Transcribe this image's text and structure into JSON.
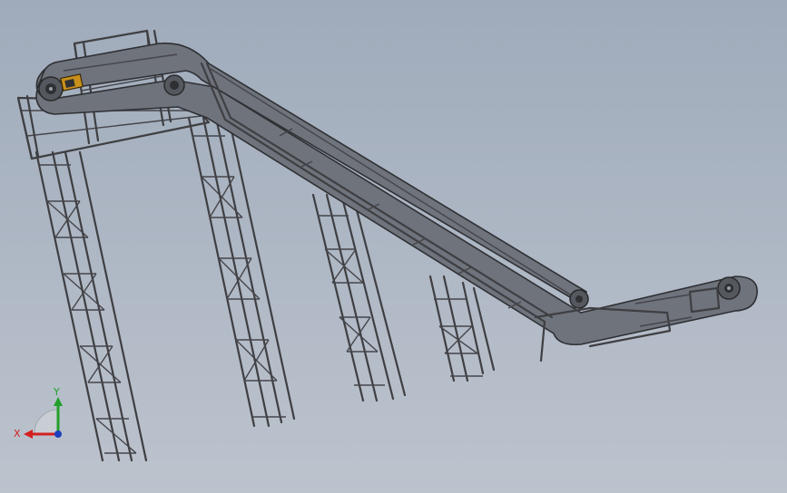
{
  "triad": {
    "x_label": "X",
    "y_label": "Y",
    "x_color": "#d42020",
    "y_color": "#22a02a",
    "z_color": "#1e3fbf"
  },
  "colors": {
    "background_top": "#9fabbb",
    "background_bottom": "#bcc3cd",
    "steel": "#3f3f42",
    "belt": "#6e737c",
    "motor_accent": "#c8901c"
  }
}
